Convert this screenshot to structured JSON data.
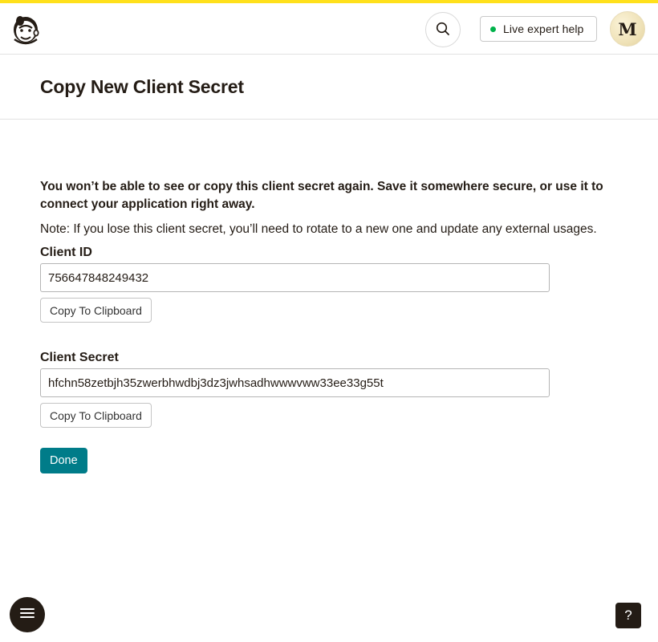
{
  "colors": {
    "brand_yellow": "#ffe01b",
    "primary_button": "#007c89",
    "live_dot": "#00b24b",
    "text": "#241c15"
  },
  "header": {
    "logo_icon": "mailchimp-freddie-logo-icon",
    "search_icon": "search-icon",
    "help_button_label": "Live expert help",
    "avatar_initial": "M"
  },
  "page": {
    "title": "Copy New Client Secret"
  },
  "content": {
    "warning": "You won’t be able to see or copy this client secret again. Save it somewhere secure, or use it to connect your application right away.",
    "note": "Note: If you lose this client secret, you’ll need to rotate to a new one and update any external usages.",
    "client_id": {
      "label": "Client ID",
      "value": "756647848249432",
      "copy_label": "Copy To Clipboard"
    },
    "client_secret": {
      "label": "Client Secret",
      "value": "hfchn58zetbjh35zwerbhwdbj3dz3jwhsadhwwwvww33ee33g55t",
      "copy_label": "Copy To Clipboard"
    },
    "done_label": "Done"
  },
  "floating": {
    "menu_icon": "hamburger-menu-icon",
    "help_label": "?"
  }
}
